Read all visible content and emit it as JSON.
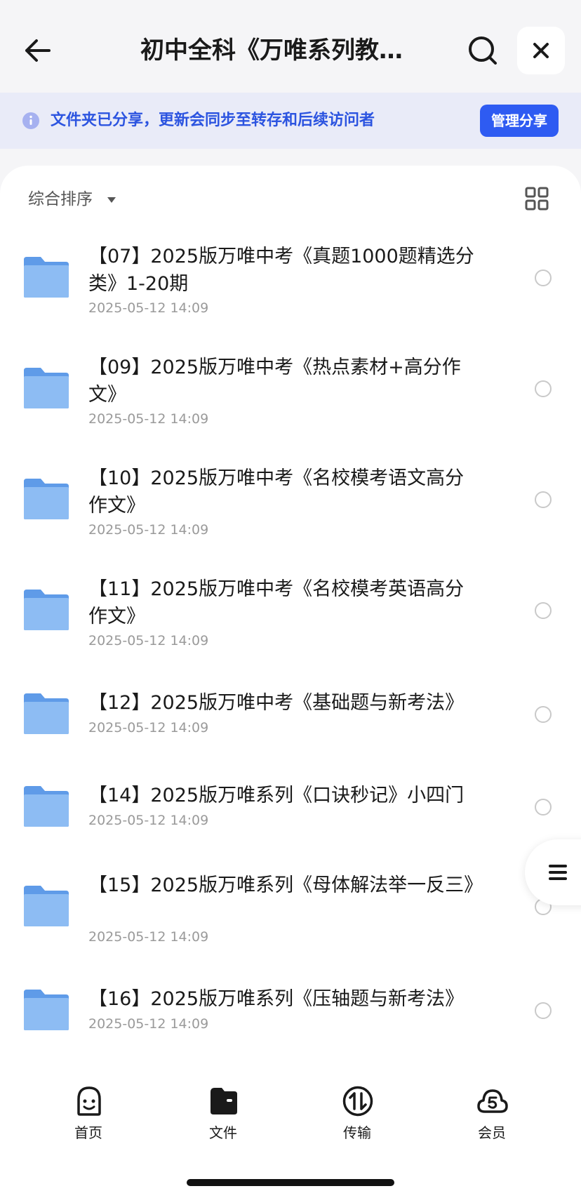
{
  "header": {
    "title": "初中全科《万唯系列教辅...",
    "back_icon": "arrow-left-icon",
    "search_icon": "search-icon",
    "close_icon": "close-icon"
  },
  "banner": {
    "text": "文件夹已分享，更新会同步至转存和后续访问者",
    "button_label": "管理分享",
    "accent": "#2e5bf2"
  },
  "toolbar": {
    "sort_label": "综合排序",
    "view_icon": "grid-view-icon"
  },
  "files": [
    {
      "title": "【07】2025版万唯中考《真题1000题精选分类》1-20期",
      "date": "2025-05-12 14:09"
    },
    {
      "title": "【09】2025版万唯中考《热点素材+高分作文》",
      "date": "2025-05-12 14:09"
    },
    {
      "title": "【10】2025版万唯中考《名校模考语文高分作文》",
      "date": "2025-05-12 14:09"
    },
    {
      "title": "【11】2025版万唯中考《名校模考英语高分作文》",
      "date": "2025-05-12 14:09"
    },
    {
      "title": "【12】2025版万唯中考《基础题与新考法》",
      "date": "2025-05-12 14:09"
    },
    {
      "title": "【14】2025版万唯系列《口诀秒记》小四门",
      "date": "2025-05-12 14:09"
    },
    {
      "title": "【15】2025版万唯系列《母体解法举一反三》",
      "date": "2025-05-12 14:09"
    },
    {
      "title": "【16】2025版万唯系列《压轴题与新考法》",
      "date": "2025-05-12 14:09"
    }
  ],
  "tabs": [
    {
      "label": "首页",
      "icon": "home-face-icon"
    },
    {
      "label": "文件",
      "icon": "wallet-file-icon"
    },
    {
      "label": "传输",
      "icon": "transfer-icon"
    },
    {
      "label": "会员",
      "icon": "vip-cloud-icon"
    }
  ]
}
